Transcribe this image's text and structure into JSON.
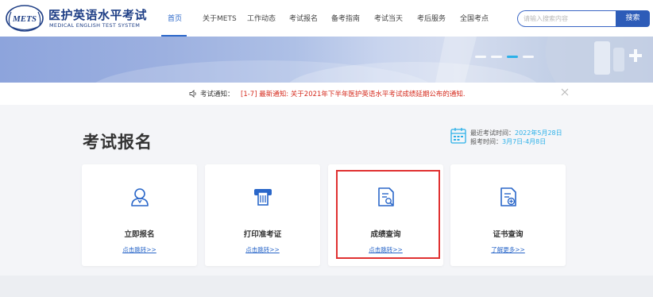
{
  "header": {
    "logo_cn": "医护英语水平考试",
    "logo_en": "MEDICAL ENGLISH TEST SYSTEM",
    "logo_mark": "METS"
  },
  "nav": {
    "items": [
      {
        "label": "首页",
        "active": true
      },
      {
        "label": "关于METS",
        "active": false
      },
      {
        "label": "工作动态",
        "active": false
      },
      {
        "label": "考试报名",
        "active": false
      },
      {
        "label": "备考指南",
        "active": false
      },
      {
        "label": "考试当天",
        "active": false
      },
      {
        "label": "考后服务",
        "active": false
      },
      {
        "label": "全国考点",
        "active": false
      }
    ]
  },
  "search": {
    "placeholder": "请输入搜索内容",
    "button_label": "搜索"
  },
  "notice": {
    "label": "考试通知：",
    "text": "[1-7] 最新通知: 关于2021年下半年医护英语水平考试成绩延期公布的通知."
  },
  "section": {
    "title": "考试报名",
    "latest_exam_label": "最近考试时间：",
    "latest_exam_value": "2022年5月28日",
    "register_label": "报考时间：",
    "register_value": "3月7日-4月8日"
  },
  "cards": [
    {
      "title": "立即报名",
      "link": "点击跳转>>",
      "icon": "user-icon"
    },
    {
      "title": "打印准考证",
      "link": "点击跳转>>",
      "icon": "printer-icon"
    },
    {
      "title": "成绩查询",
      "link": "点击跳转>>",
      "icon": "document-search-icon"
    },
    {
      "title": "证书查询",
      "link": "了解更多>>",
      "icon": "document-add-icon"
    }
  ],
  "colors": {
    "brand": "#1f3f86",
    "accent": "#2a67c9",
    "notice_red": "#d52b1e",
    "highlight": "#e03131",
    "date_highlight": "#2bb0e8"
  }
}
